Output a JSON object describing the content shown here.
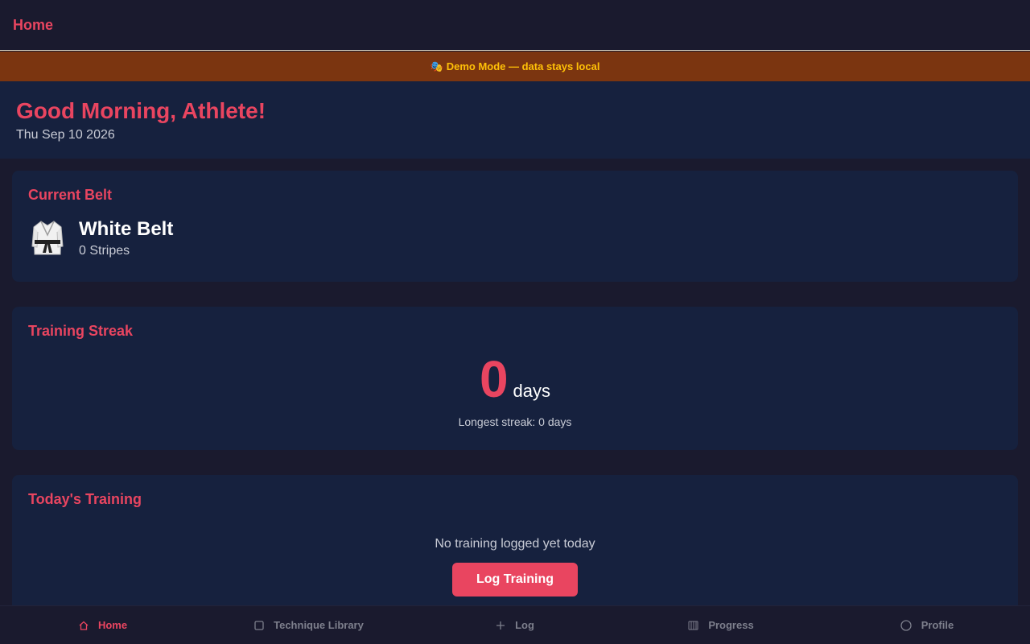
{
  "header": {
    "title": "Home"
  },
  "banner": {
    "icon": "theater-mask-icon",
    "text": "Demo Mode — data stays local"
  },
  "greeting": {
    "title": "Good Morning, Athlete!",
    "date": "Thu Sep 10 2026"
  },
  "belt_card": {
    "title": "Current Belt",
    "icon": "gi-icon",
    "belt": "White Belt",
    "stripes": "0 Stripes"
  },
  "streak_card": {
    "title": "Training Streak",
    "count": "0",
    "unit": "days",
    "longest": "Longest streak: 0 days"
  },
  "training_card": {
    "title": "Today's Training",
    "empty": "No training logged yet today",
    "button": "Log Training"
  },
  "nav": {
    "items": [
      {
        "label": "Home",
        "icon": "home-icon",
        "active": true
      },
      {
        "label": "Technique Library",
        "icon": "book-icon",
        "active": false
      },
      {
        "label": "Log",
        "icon": "plus-icon",
        "active": false
      },
      {
        "label": "Progress",
        "icon": "chart-icon",
        "active": false
      },
      {
        "label": "Profile",
        "icon": "person-icon",
        "active": false
      }
    ]
  },
  "colors": {
    "accent": "#e94560",
    "background": "#1a1a2e",
    "card": "#16213e",
    "banner": "#7b3510",
    "banner_text": "#ffc107"
  }
}
